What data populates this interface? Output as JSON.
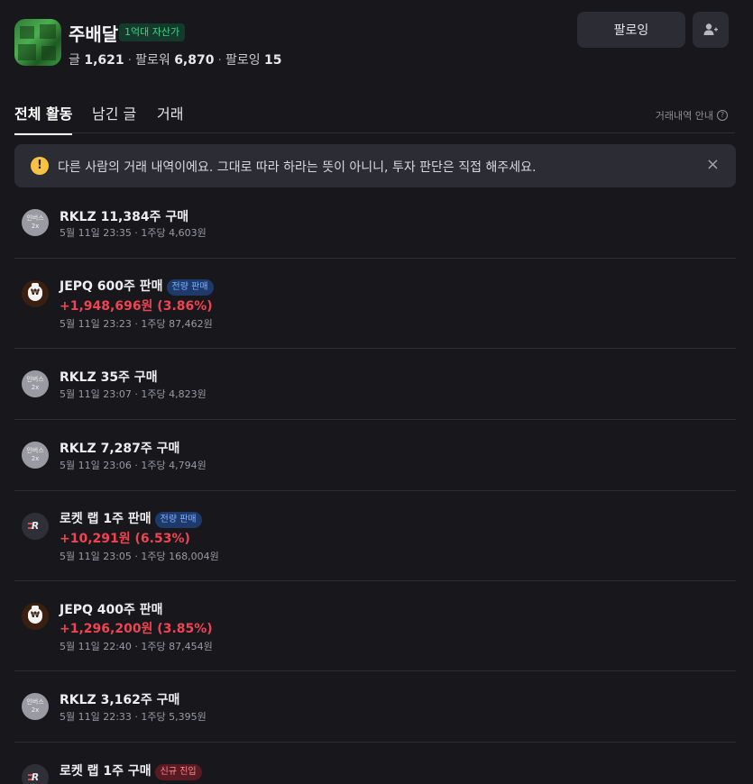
{
  "profile": {
    "name": "주배달",
    "badge": "1억대 자산가",
    "stats": {
      "posts_label": "글",
      "posts": "1,621",
      "followers_label": "팔로워",
      "followers": "6,870",
      "following_label": "팔로잉",
      "following": "15"
    },
    "follow_button": "팔로잉"
  },
  "tabs": [
    {
      "label": "전체 활동",
      "active": true
    },
    {
      "label": "남긴 글",
      "active": false
    },
    {
      "label": "거래",
      "active": false
    }
  ],
  "guide": {
    "label": "거래내역 안내",
    "icon": "question-icon"
  },
  "notice": {
    "icon": "warning-icon",
    "text": "다른 사람의 거래 내역이에요. 그대로 따라 하라는 뜻이 아니니, 투자 판단은 직접 해주세요.",
    "close": "×"
  },
  "trades": [
    {
      "icon": "inverse-2x",
      "icon_text": [
        "인버스",
        "2x"
      ],
      "title": "RKLZ 11,384주 구매",
      "tag": "",
      "profit": "",
      "meta": "5월 11일 23:35 · 1주당 4,603원"
    },
    {
      "icon": "jepq",
      "icon_text": [
        "₩"
      ],
      "title": "JEPQ 600주 판매",
      "tag": "전량 판매",
      "tag_color": "blue",
      "profit": "+1,948,696원 (3.86%)",
      "meta": "5월 11일 23:23 · 1주당 87,462원"
    },
    {
      "icon": "inverse-2x",
      "icon_text": [
        "인버스",
        "2x"
      ],
      "title": "RKLZ 35주 구매",
      "tag": "",
      "profit": "",
      "meta": "5월 11일 23:07 · 1주당 4,823원"
    },
    {
      "icon": "inverse-2x",
      "icon_text": [
        "인버스",
        "2x"
      ],
      "title": "RKLZ 7,287주 구매",
      "tag": "",
      "profit": "",
      "meta": "5월 11일 23:06 · 1주당 4,794원"
    },
    {
      "icon": "rocket",
      "icon_text": [
        "R"
      ],
      "title": "로켓 랩 1주 판매",
      "tag": "전량 판매",
      "tag_color": "blue",
      "profit": "+10,291원 (6.53%)",
      "meta": "5월 11일 23:05 · 1주당 168,004원"
    },
    {
      "icon": "jepq",
      "icon_text": [
        "₩"
      ],
      "title": "JEPQ 400주 판매",
      "tag": "",
      "profit": "+1,296,200원 (3.85%)",
      "meta": "5월 11일 22:40 · 1주당 87,454원"
    },
    {
      "icon": "inverse-2x",
      "icon_text": [
        "인버스",
        "2x"
      ],
      "title": "RKLZ 3,162주 구매",
      "tag": "",
      "profit": "",
      "meta": "5월 11일 22:33 · 1주당 5,395원"
    },
    {
      "icon": "rocket",
      "icon_text": [
        "R"
      ],
      "title": "로켓 랩 1주 구매",
      "tag": "신규 진입",
      "tag_color": "red",
      "profit": "",
      "meta": ""
    }
  ]
}
